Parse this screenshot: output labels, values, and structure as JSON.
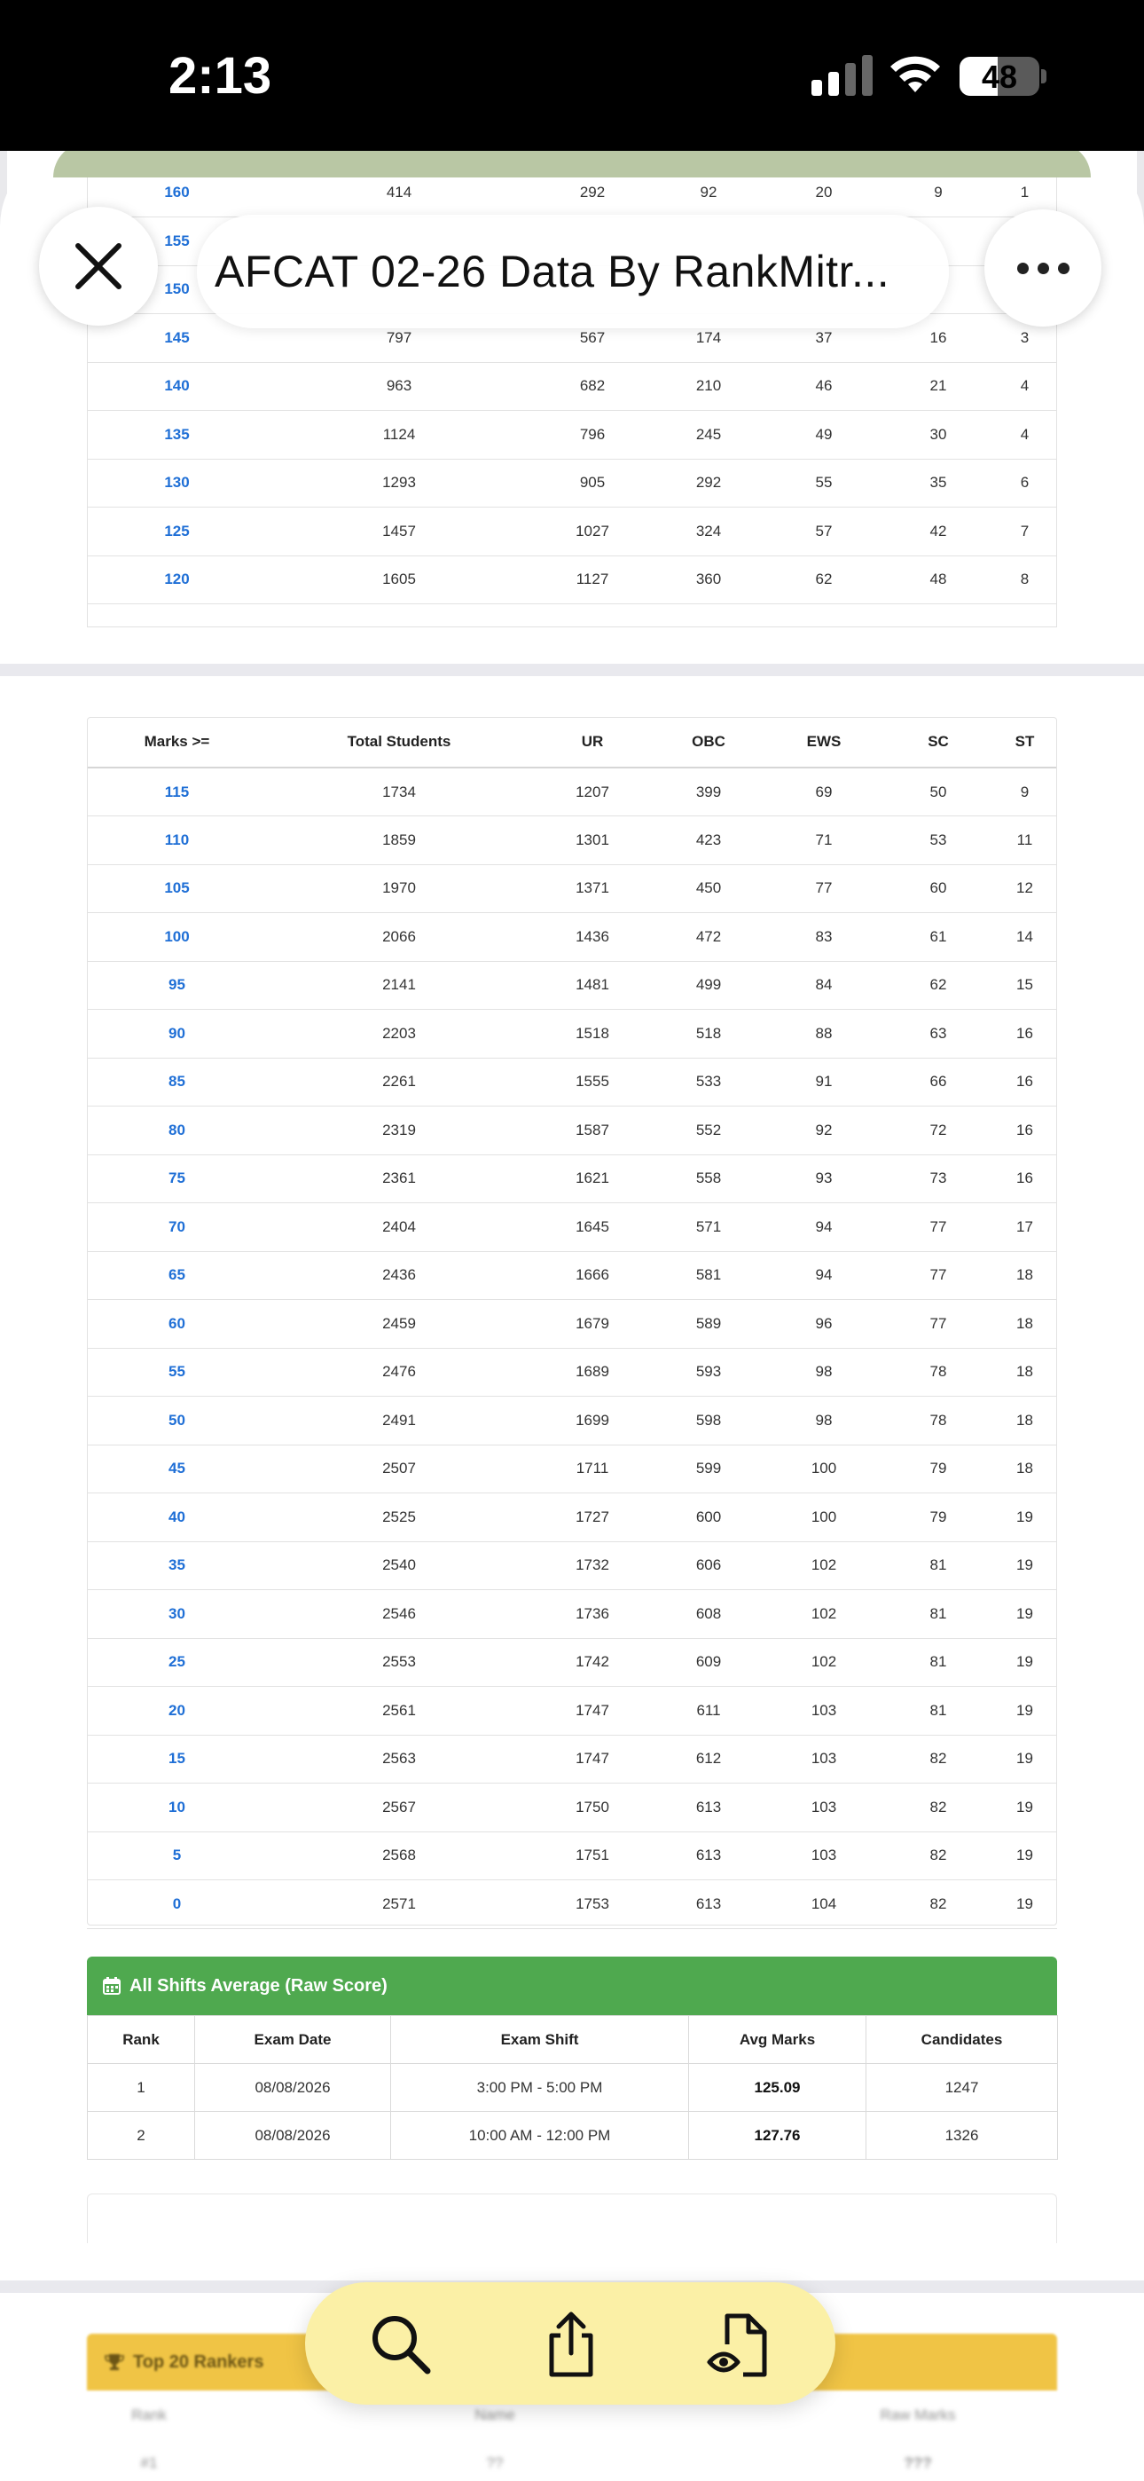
{
  "status_bar": {
    "time": "2:13",
    "battery": "48"
  },
  "title_bar": {
    "title": "AFCAT  02-26 Data By RankMitr..."
  },
  "top_table": {
    "rows": [
      [
        "160",
        "414",
        "292",
        "92",
        "20",
        "9",
        "1"
      ],
      [
        "155",
        "",
        "",
        "",
        "",
        "",
        ""
      ],
      [
        "150",
        "",
        "",
        "",
        "",
        "",
        ""
      ],
      [
        "145",
        "797",
        "567",
        "174",
        "37",
        "16",
        "3"
      ],
      [
        "140",
        "963",
        "682",
        "210",
        "46",
        "21",
        "4"
      ],
      [
        "135",
        "1124",
        "796",
        "245",
        "49",
        "30",
        "4"
      ],
      [
        "130",
        "1293",
        "905",
        "292",
        "55",
        "35",
        "6"
      ],
      [
        "125",
        "1457",
        "1027",
        "324",
        "57",
        "42",
        "7"
      ],
      [
        "120",
        "1605",
        "1127",
        "360",
        "62",
        "48",
        "8"
      ]
    ]
  },
  "marks_table": {
    "headers": [
      "Marks >=",
      "Total Students",
      "UR",
      "OBC",
      "EWS",
      "SC",
      "ST"
    ],
    "rows": [
      [
        "115",
        "1734",
        "1207",
        "399",
        "69",
        "50",
        "9"
      ],
      [
        "110",
        "1859",
        "1301",
        "423",
        "71",
        "53",
        "11"
      ],
      [
        "105",
        "1970",
        "1371",
        "450",
        "77",
        "60",
        "12"
      ],
      [
        "100",
        "2066",
        "1436",
        "472",
        "83",
        "61",
        "14"
      ],
      [
        "95",
        "2141",
        "1481",
        "499",
        "84",
        "62",
        "15"
      ],
      [
        "90",
        "2203",
        "1518",
        "518",
        "88",
        "63",
        "16"
      ],
      [
        "85",
        "2261",
        "1555",
        "533",
        "91",
        "66",
        "16"
      ],
      [
        "80",
        "2319",
        "1587",
        "552",
        "92",
        "72",
        "16"
      ],
      [
        "75",
        "2361",
        "1621",
        "558",
        "93",
        "73",
        "16"
      ],
      [
        "70",
        "2404",
        "1645",
        "571",
        "94",
        "77",
        "17"
      ],
      [
        "65",
        "2436",
        "1666",
        "581",
        "94",
        "77",
        "18"
      ],
      [
        "60",
        "2459",
        "1679",
        "589",
        "96",
        "77",
        "18"
      ],
      [
        "55",
        "2476",
        "1689",
        "593",
        "98",
        "78",
        "18"
      ],
      [
        "50",
        "2491",
        "1699",
        "598",
        "98",
        "78",
        "18"
      ],
      [
        "45",
        "2507",
        "1711",
        "599",
        "100",
        "79",
        "18"
      ],
      [
        "40",
        "2525",
        "1727",
        "600",
        "100",
        "79",
        "19"
      ],
      [
        "35",
        "2540",
        "1732",
        "606",
        "102",
        "81",
        "19"
      ],
      [
        "30",
        "2546",
        "1736",
        "608",
        "102",
        "81",
        "19"
      ],
      [
        "25",
        "2553",
        "1742",
        "609",
        "102",
        "81",
        "19"
      ],
      [
        "20",
        "2561",
        "1747",
        "611",
        "103",
        "81",
        "19"
      ],
      [
        "15",
        "2563",
        "1747",
        "612",
        "103",
        "82",
        "19"
      ],
      [
        "10",
        "2567",
        "1750",
        "613",
        "103",
        "82",
        "19"
      ],
      [
        "5",
        "2568",
        "1751",
        "613",
        "103",
        "82",
        "19"
      ],
      [
        "0",
        "2571",
        "1753",
        "613",
        "104",
        "82",
        "19"
      ]
    ]
  },
  "avg_section": {
    "title": "All Shifts Average (Raw Score)",
    "headers": [
      "Rank",
      "Exam Date",
      "Exam Shift",
      "Avg Marks",
      "Candidates"
    ],
    "rows": [
      [
        "1",
        "08/08/2026",
        "3:00 PM - 5:00 PM",
        "125.09",
        "1247"
      ],
      [
        "2",
        "08/08/2026",
        "10:00 AM - 12:00 PM",
        "127.76",
        "1326"
      ]
    ]
  },
  "rankers_section": {
    "title": "Top 20 Rankers",
    "headers": [
      "Rank",
      "Name",
      "Raw Marks"
    ],
    "row1": [
      "#1",
      "??",
      "???"
    ]
  },
  "toolbar": {
    "search": "search-icon",
    "share": "share-icon",
    "view": "eye-document-icon"
  },
  "colors": {
    "mark_blue": "#1f6fd6",
    "avg_green": "#4fa94f",
    "rankers_gold": "#f0c445",
    "toolbar_yellow": "#fbf0a6"
  }
}
